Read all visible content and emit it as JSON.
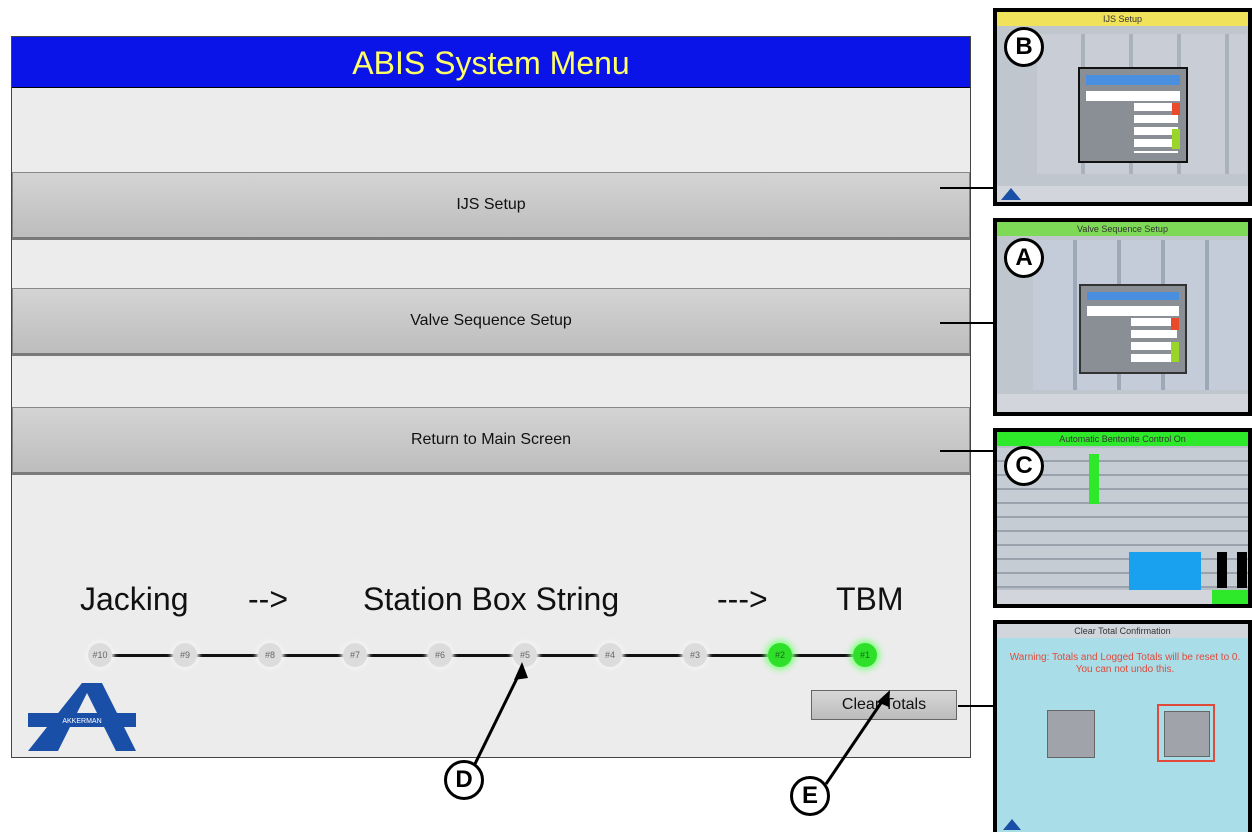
{
  "screen": {
    "title": "ABIS System Menu",
    "buttons": {
      "ijs": "IJS Setup",
      "valve": "Valve Sequence Setup",
      "return": "Return to Main Screen"
    },
    "flow": {
      "jacking": "Jacking",
      "arrow1": "-->",
      "station": "Station Box String",
      "arrow2": "--->",
      "tbm": "TBM"
    },
    "sequence": [
      {
        "label": "#10",
        "active": false
      },
      {
        "label": "#9",
        "active": false
      },
      {
        "label": "#8",
        "active": false
      },
      {
        "label": "#7",
        "active": false
      },
      {
        "label": "#6",
        "active": false
      },
      {
        "label": "#5",
        "active": false
      },
      {
        "label": "#4",
        "active": false
      },
      {
        "label": "#3",
        "active": false
      },
      {
        "label": "#2",
        "active": true
      },
      {
        "label": "#1",
        "active": true
      }
    ],
    "clear_totals": "Clear Totals",
    "logo_text": "AKKERMAN"
  },
  "thumbnails": {
    "b": {
      "title": "IJS Setup",
      "callout": "B"
    },
    "a": {
      "title": "Valve Sequence Setup",
      "callout": "A"
    },
    "c": {
      "title": "Automatic Bentonite Control On",
      "callout": "C"
    },
    "e": {
      "title": "Clear Total Confirmation",
      "callout": "E",
      "warning": "Warning: Totals and Logged Totals will be reset to 0. You can not undo this."
    }
  },
  "callouts": {
    "d": "D",
    "e": "E"
  },
  "colors": {
    "title_bg": "#0a14e8",
    "title_text": "#ffff66",
    "active_node": "#2fe02a",
    "logo": "#1a4fa8"
  }
}
